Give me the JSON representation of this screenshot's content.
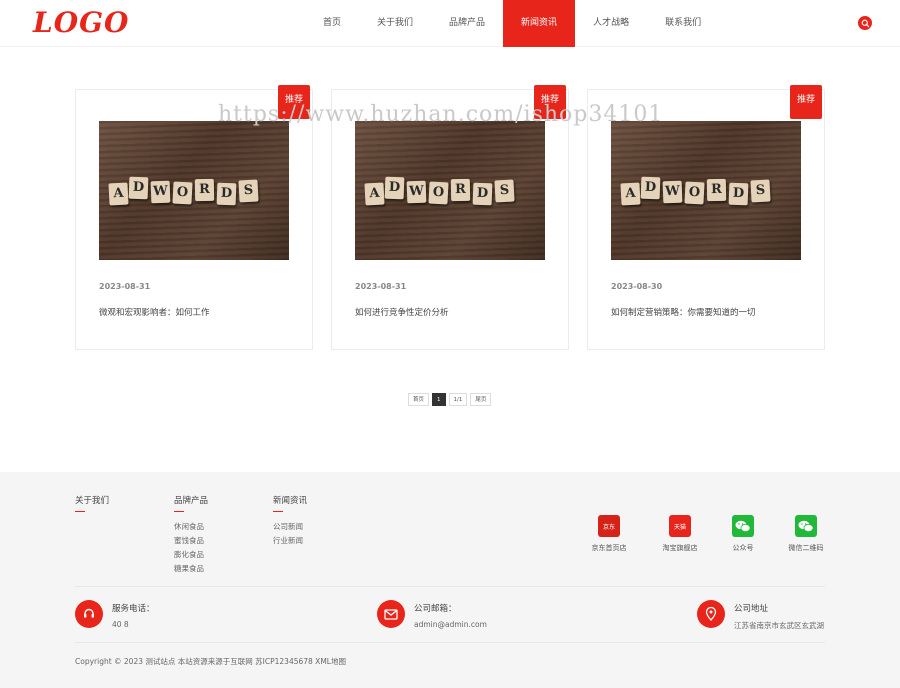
{
  "header": {
    "logo": "LOGO",
    "nav": [
      "首页",
      "关于我们",
      "品牌产品",
      "新闻资讯",
      "人才战略",
      "联系我们"
    ],
    "active_index": 3
  },
  "watermark": "https://www.huzhan.com/ishop34101",
  "cards": [
    {
      "badge": "推荐",
      "image_text": "ADWORDS",
      "date": "2023-08-31",
      "title": "微观和宏观影响者：如何工作"
    },
    {
      "badge": "推荐",
      "image_text": "ADWORDS",
      "date": "2023-08-31",
      "title": "如何进行竞争性定价分析"
    },
    {
      "badge": "推荐",
      "image_text": "ADWORDS",
      "date": "2023-08-30",
      "title": "如何制定营销策略：你需要知道的一切"
    }
  ],
  "pagination": {
    "first": "首页",
    "current": "1",
    "pages": "1/1",
    "last": "尾页"
  },
  "footer": {
    "columns": [
      {
        "title": "关于我们",
        "links": []
      },
      {
        "title": "品牌产品",
        "links": [
          "休闲食品",
          "蜜饯食品",
          "膨化食品",
          "糖果食品"
        ]
      },
      {
        "title": "新闻资讯",
        "links": [
          "公司新闻",
          "行业新闻"
        ]
      }
    ],
    "social": [
      {
        "label": "京东首页店",
        "icon": "jd-icon",
        "color": "#d6231a",
        "glyph": "京东"
      },
      {
        "label": "淘宝旗舰店",
        "icon": "tmall-icon",
        "color": "#e8251b",
        "glyph": "天猫"
      },
      {
        "label": "公众号",
        "icon": "wechat-icon",
        "color": "#22b83a",
        "glyph": ""
      },
      {
        "label": "微信二维码",
        "icon": "wechat-icon",
        "color": "#22b83a",
        "glyph": ""
      }
    ],
    "contacts": [
      {
        "title": "服务电话：",
        "value": "40            8",
        "icon": "headset-icon"
      },
      {
        "title": "公司邮箱：",
        "value": "admin@admin.com",
        "icon": "mail-icon"
      },
      {
        "title": "公司地址",
        "value": "江苏省南京市玄武区玄武湖",
        "icon": "location-icon"
      }
    ],
    "copyright": "Copyright © 2023 测试站点 本站资源来源于互联网 苏ICP12345678 XML地图"
  },
  "colors": {
    "accent": "#e8251b",
    "footer_bg": "#f5f5f5"
  }
}
